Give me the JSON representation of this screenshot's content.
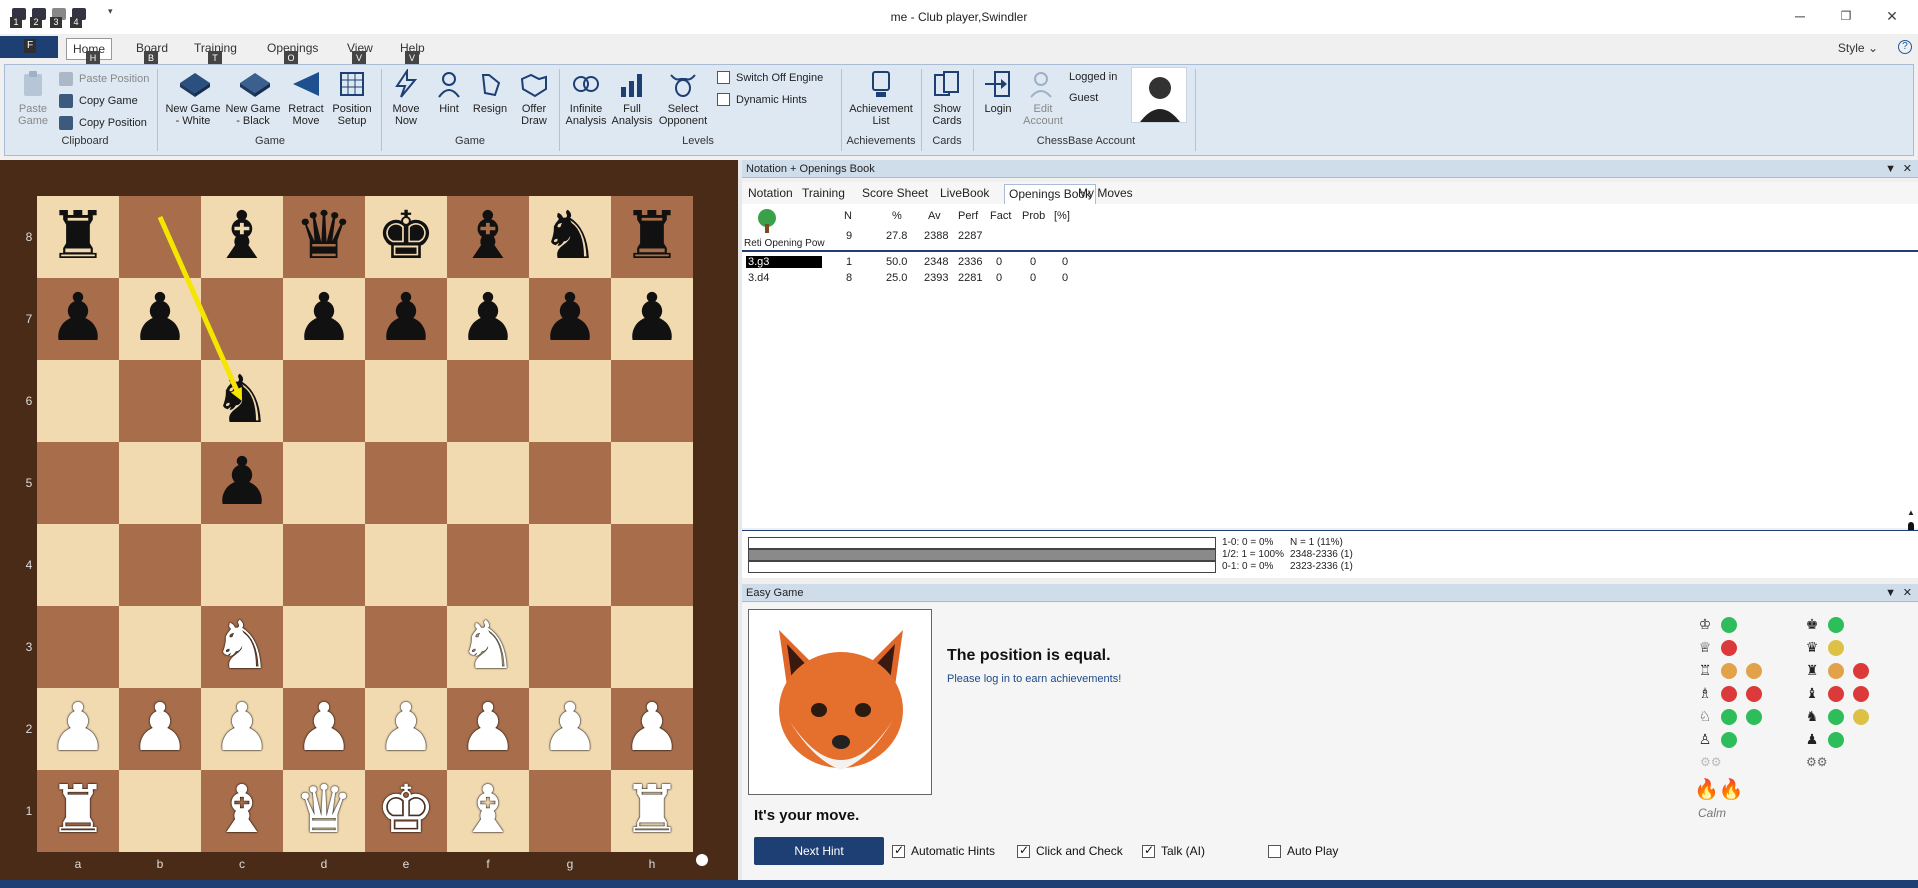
{
  "window": {
    "title": "me - Club player,Swindler",
    "min": "─",
    "restore": "❐",
    "close": "✕"
  },
  "quick_access": [
    "1",
    "2",
    "3",
    "4"
  ],
  "menu": {
    "file_key": "F",
    "tabs": [
      {
        "label": "Home",
        "key": "H"
      },
      {
        "label": "Board",
        "key": "B"
      },
      {
        "label": "Training",
        "key": "T"
      },
      {
        "label": "Openings",
        "key": "O"
      },
      {
        "label": "View",
        "key": "V"
      },
      {
        "label": "Help",
        "key": "V"
      }
    ],
    "style_label": "Style",
    "help_icon": "?"
  },
  "ribbon": {
    "clipboard": {
      "paste_game": "Paste Game",
      "paste_position": "Paste Position",
      "copy_game": "Copy Game",
      "copy_position": "Copy Position",
      "label": "Clipboard"
    },
    "game": {
      "new_white": "New Game - White",
      "new_black": "New Game - Black",
      "retract": "Retract Move",
      "setup": "Position Setup",
      "label": "Game"
    },
    "game2": {
      "move_now": "Move Now",
      "hint": "Hint",
      "resign": "Resign",
      "offer_draw": "Offer Draw",
      "label": "Game"
    },
    "levels": {
      "infinite": "Infinite Analysis",
      "full": "Full Analysis",
      "select": "Select Opponent",
      "switch_off": "Switch Off Engine",
      "dynamic": "Dynamic Hints",
      "label": "Levels"
    },
    "achievements": {
      "list": "Achievement List",
      "label": "Achievements"
    },
    "cards": {
      "show": "Show Cards",
      "label": "Cards"
    },
    "account": {
      "login": "Login",
      "edit": "Edit Account",
      "logged_in": "Logged in",
      "user": "Guest",
      "label": "ChessBase Account"
    }
  },
  "board": {
    "ranks": [
      "8",
      "7",
      "6",
      "5",
      "4",
      "3",
      "2",
      "1"
    ],
    "files": [
      "a",
      "b",
      "c",
      "d",
      "e",
      "f",
      "g",
      "h"
    ],
    "position": [
      [
        "bR",
        "",
        "bB",
        "bQ",
        "bK",
        "bB",
        "bN",
        "bR"
      ],
      [
        "bP",
        "bP",
        "",
        "bP",
        "bP",
        "bP",
        "bP",
        "bP"
      ],
      [
        "",
        "",
        "bN",
        "",
        "",
        "",
        "",
        ""
      ],
      [
        "",
        "",
        "bP",
        "",
        "",
        "",
        "",
        ""
      ],
      [
        "",
        "",
        "",
        "",
        "",
        "",
        "",
        ""
      ],
      [
        "",
        "",
        "wN",
        "",
        "",
        "wN",
        "",
        ""
      ],
      [
        "wP",
        "wP",
        "wP",
        "wP",
        "wP",
        "wP",
        "wP",
        "wP"
      ],
      [
        "wR",
        "",
        "wB",
        "wQ",
        "wK",
        "wB",
        "",
        "wR"
      ]
    ],
    "arrow": {
      "from": "b8",
      "to": "c6",
      "color": "#f5e600"
    }
  },
  "notation": {
    "panel_title": "Notation + Openings Book",
    "tabs": [
      "Notation",
      "Training",
      "Score Sheet",
      "LiveBook",
      "Openings Book",
      "My Moves"
    ],
    "active_tab": "Openings Book",
    "head": {
      "cols": [
        "N",
        "%",
        "Av",
        "Perf",
        "Fact",
        "Prob",
        "[%]"
      ],
      "opening": "Reti Opening Pow",
      "N": "9",
      "pct": "27.8",
      "Av": "2388",
      "Perf": "2287"
    },
    "moves": [
      {
        "move": "3.g3",
        "N": "1",
        "pct": "50.0",
        "Av": "2348",
        "Perf": "2336",
        "Fact": "0",
        "Prob": "0",
        "P": "0"
      },
      {
        "move": "3.d4",
        "N": "8",
        "pct": "25.0",
        "Av": "2393",
        "Perf": "2281",
        "Fact": "0",
        "Prob": "0",
        "P": "0"
      }
    ],
    "stats": {
      "white": "1-0: 0 = 0%",
      "draw": "1/2: 1 = 100%",
      "black": "0-1: 0 = 0%",
      "n": "N = 1 (11%)",
      "r1": "2348-2336 (1)",
      "r2": "2323-2336 (1)",
      "draw_fraction": 1.0
    }
  },
  "easy": {
    "panel_title": "Easy Game",
    "status": "The position is equal.",
    "login_msg": "Please log in to earn achievements!",
    "your_move": "It's your move.",
    "next_hint": "Next Hint",
    "options": [
      {
        "label": "Automatic Hints",
        "checked": true
      },
      {
        "label": "Click and Check",
        "checked": true
      },
      {
        "label": "Talk (AI)",
        "checked": true
      },
      {
        "label": "Auto Play",
        "checked": false
      }
    ],
    "mood": "Calm",
    "white_pieces": [
      "♔",
      "♕",
      "♖",
      "♗",
      "♘",
      "♙"
    ],
    "black_pieces": [
      "♚",
      "♛",
      "♜",
      "♝",
      "♞",
      "♟"
    ]
  }
}
